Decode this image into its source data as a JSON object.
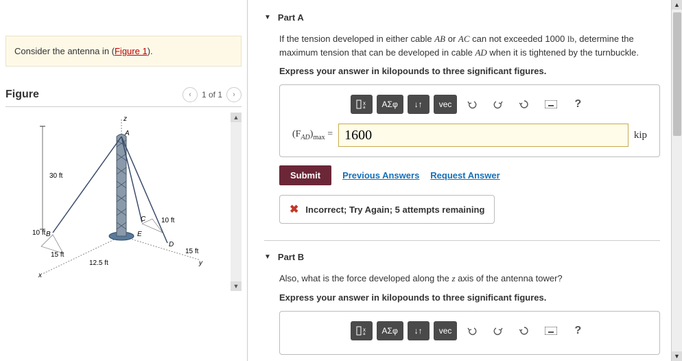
{
  "prompt": {
    "pre": "Consider the antenna in (",
    "link": "Figure 1",
    "post": ")."
  },
  "figure": {
    "title": "Figure",
    "pager": "1 of 1",
    "labels": {
      "z": "z",
      "x": "x",
      "y": "y",
      "A": "A",
      "B": "B",
      "C": "C",
      "D": "D",
      "E": "E",
      "h30": "30 ft",
      "d10a": "10 ft",
      "d10b": "10 ft",
      "d15a": "15 ft",
      "d15b": "15 ft",
      "d125": "12.5 ft"
    }
  },
  "partA": {
    "title": "Part A",
    "q1": "If the tension developed in either cable ",
    "ab": "AB",
    "or": " or ",
    "ac": "AC",
    "q2": " can not exceeded 1000 ",
    "lb": "lb",
    "q3": ", determine the maximum tension that can be developed in cable ",
    "ad": "AD",
    "q4": " when it is tightened by the turnbuckle.",
    "instruction": "Express your answer in kilopounds to three significant figures.",
    "toolbar": {
      "greek": "ΑΣφ",
      "vec": "vec",
      "help": "?"
    },
    "label_pre": "(F",
    "label_sub": "AD",
    "label_post": ")",
    "label_max": "max",
    "eq": " = ",
    "value": "1600",
    "unit": "kip",
    "submit": "Submit",
    "prev": "Previous Answers",
    "req": "Request Answer",
    "feedback": "Incorrect; Try Again; 5 attempts remaining"
  },
  "partB": {
    "title": "Part B",
    "q1": "Also, what is the force developed along the ",
    "z": "z",
    "q2": " axis of the antenna tower?",
    "instruction": "Express your answer in kilopounds to three significant figures.",
    "toolbar": {
      "greek": "ΑΣφ",
      "vec": "vec",
      "help": "?"
    }
  }
}
